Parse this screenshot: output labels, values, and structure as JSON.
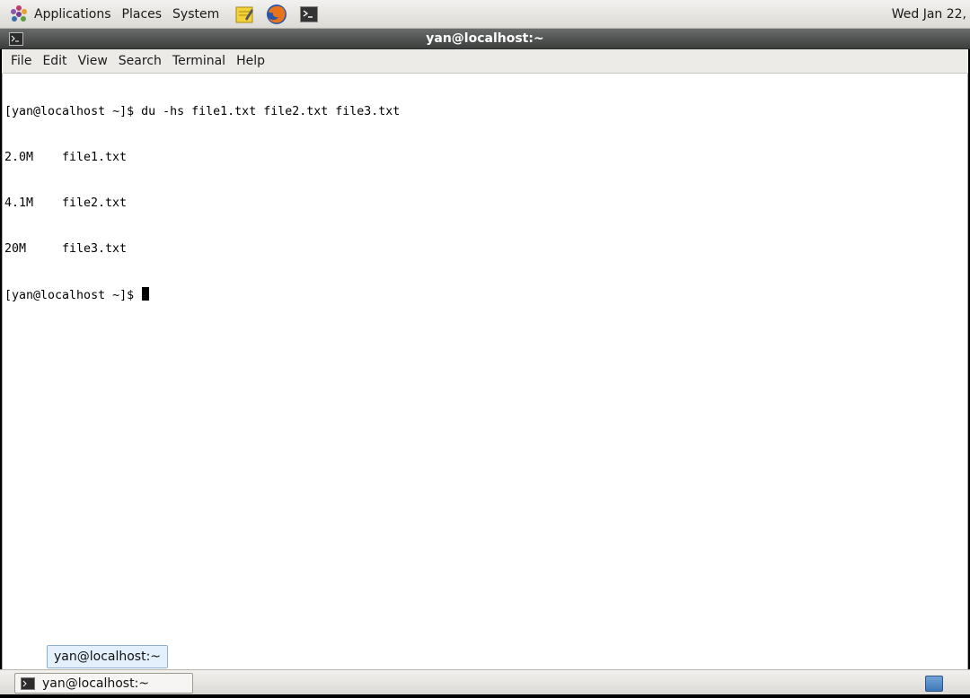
{
  "top_panel": {
    "menus": [
      "Applications",
      "Places",
      "System"
    ],
    "launchers": [
      "notes-icon",
      "firefox-icon",
      "terminal-icon"
    ],
    "clock": "Wed Jan 22,"
  },
  "window": {
    "title": "yan@localhost:~",
    "menu": [
      "File",
      "Edit",
      "View",
      "Search",
      "Terminal",
      "Help"
    ]
  },
  "terminal": {
    "prompt": "[yan@localhost ~]$ ",
    "command": "du -hs file1.txt file2.txt file3.txt",
    "output": [
      {
        "size": "2.0M",
        "file": "file1.txt"
      },
      {
        "size": "4.1M",
        "file": "file2.txt"
      },
      {
        "size": "20M",
        "file": "file3.txt"
      }
    ],
    "final_prompt": "[yan@localhost ~]$ "
  },
  "tooltip": {
    "text": "yan@localhost:~"
  },
  "taskbar": {
    "task_label": "yan@localhost:~"
  },
  "colors": {
    "titlebar": "#4f5150",
    "tooltip_bg": "#e4f0fb",
    "workspace": "#4f86c6"
  }
}
